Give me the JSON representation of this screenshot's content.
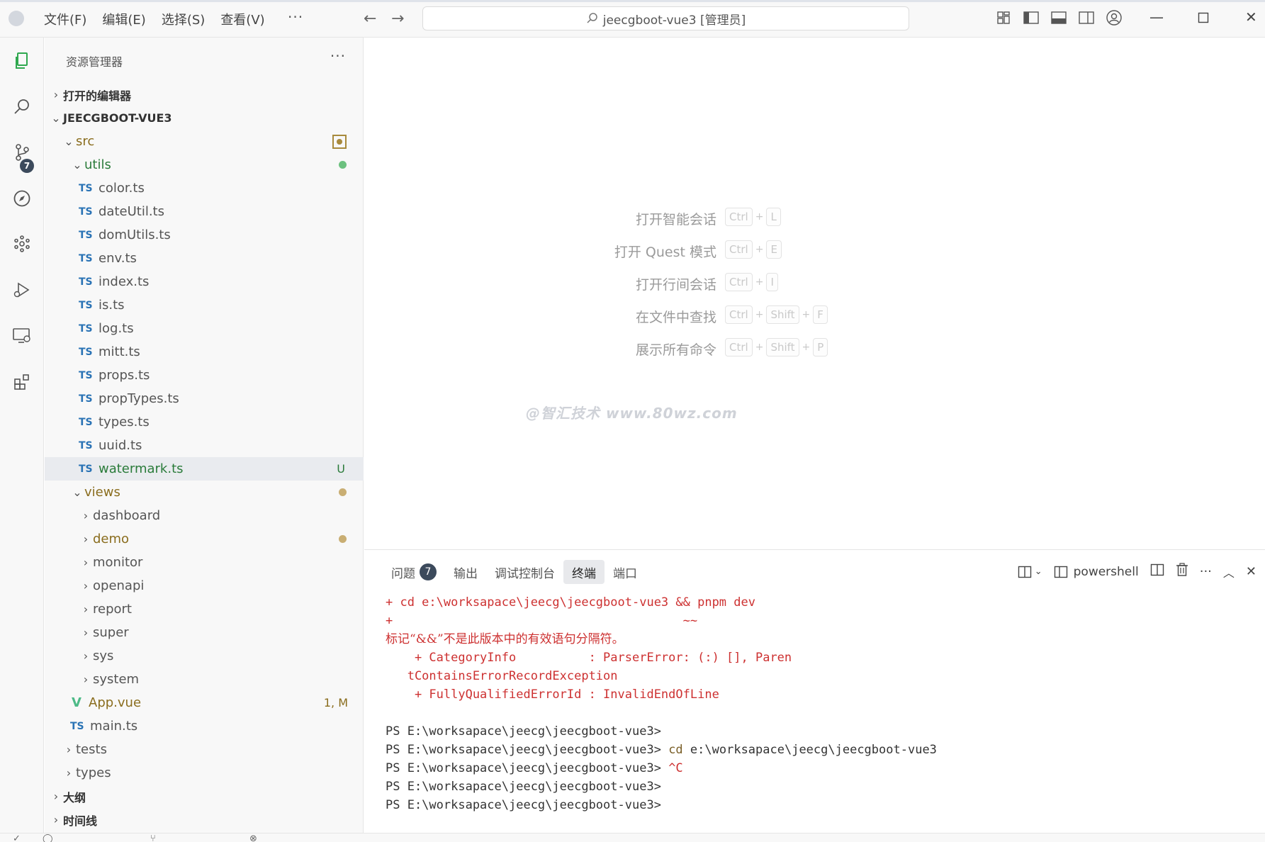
{
  "window": {
    "title": "jeecgboot-vue3 [管理员]",
    "menu": [
      "文件(F)",
      "编辑(E)",
      "选择(S)",
      "查看(V)"
    ],
    "menu_more": "···"
  },
  "activity": {
    "scm_badge": "7"
  },
  "sidebar": {
    "title": "资源管理器",
    "more": "···",
    "open_editors": "打开的编辑器",
    "root": "JEECGBOOT-VUE3",
    "src": "src",
    "utils": "utils",
    "util_files": [
      "color.ts",
      "dateUtil.ts",
      "domUtils.ts",
      "env.ts",
      "index.ts",
      "is.ts",
      "log.ts",
      "mitt.ts",
      "props.ts",
      "propTypes.ts",
      "types.ts",
      "uuid.ts"
    ],
    "ts_tag": "TS",
    "watermark_file": "watermark.ts",
    "watermark_status": "U",
    "views": "views",
    "view_folders": [
      "dashboard",
      "demo",
      "monitor",
      "openapi",
      "report",
      "super",
      "sys",
      "system"
    ],
    "app_vue": "App.vue",
    "app_vue_status": "1, M",
    "main_ts": "main.ts",
    "tests": "tests",
    "types": "types",
    "outline": "大纲",
    "timeline": "时间线"
  },
  "editor": {
    "shortcuts": [
      {
        "label": "打开智能会话",
        "keys": [
          "Ctrl",
          "L"
        ]
      },
      {
        "label": "打开 Quest 模式",
        "keys": [
          "Ctrl",
          "E"
        ]
      },
      {
        "label": "打开行间会话",
        "keys": [
          "Ctrl",
          "I"
        ]
      },
      {
        "label": "在文件中查找",
        "keys": [
          "Ctrl",
          "Shift",
          "F"
        ]
      },
      {
        "label": "展示所有命令",
        "keys": [
          "Ctrl",
          "Shift",
          "P"
        ]
      }
    ],
    "plus": "+",
    "watermark": "@智汇技术 www.80wz.com"
  },
  "panel": {
    "tabs": [
      "问题",
      "输出",
      "调试控制台",
      "终端",
      "端口"
    ],
    "problems_count": "7",
    "active_tab": "终端",
    "shell": "powershell",
    "terminal": {
      "line1": "+ cd e:\\worksapace\\jeecg\\jeecgboot-vue3 && pnpm dev",
      "line2": "+                                        ~~",
      "line3": "标记“&&”不是此版本中的有效语句分隔符。",
      "line4": "    + CategoryInfo          : ParserError: (:) [], Paren",
      "line5": "   tContainsErrorRecordException",
      "line6": "    + FullyQualifiedErrorId : InvalidEndOfLine",
      "prompt": "PS E:\\worksapace\\jeecg\\jeecgboot-vue3>",
      "cmd_cd": "cd",
      "cmd_cd_arg": "e:\\worksapace\\jeecg\\jeecgboot-vue3",
      "cmd_ctrl_c": "^C"
    }
  },
  "colors": {
    "accent": "#2a73b5",
    "terminal_error": "#cd3131",
    "git_untracked": "#2a7b3a",
    "git_modified": "#8a6d1e",
    "badge": "#3c4a5c"
  }
}
